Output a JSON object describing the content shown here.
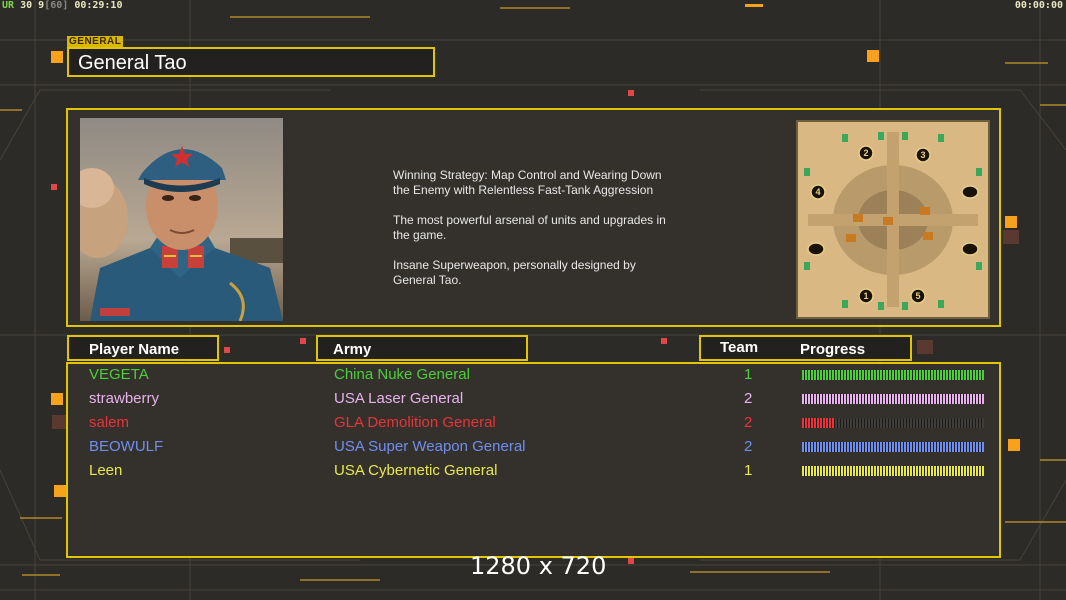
{
  "hud": {
    "rank": "UR",
    "fps": "30",
    "fps_min": "9",
    "fps_cap": "[60]",
    "elapsed": "00:29:10",
    "timer": "00:00:00"
  },
  "general": {
    "tag": "GENERAL",
    "name": "General Tao"
  },
  "description": [
    "Winning Strategy: Map Control and Wearing Down\n the Enemy with Relentless Fast-Tank Aggression",
    "The most powerful arsenal of units and upgrades in\n the game.",
    "Insane Superweapon, personally designed by\n General Tao."
  ],
  "minimap": {
    "start_positions": [
      "1",
      "2",
      "3",
      "4",
      "5"
    ]
  },
  "table": {
    "headers": {
      "player": "Player Name",
      "army": "Army",
      "team": "Team",
      "progress": "Progress"
    },
    "rows": [
      {
        "player": "VEGETA",
        "army": "China Nuke General",
        "team": "1",
        "progress": 1.0,
        "color": "#4ccf3a"
      },
      {
        "player": "strawberry",
        "army": "USA Laser General",
        "team": "2",
        "progress": 1.0,
        "color": "#e8b2ec"
      },
      {
        "player": "salem",
        "army": "GLA Demolition General",
        "team": "2",
        "progress": 0.18,
        "color": "#e8333a"
      },
      {
        "player": "BEOWULF",
        "army": "USA Super Weapon General",
        "team": "2",
        "progress": 1.0,
        "color": "#6f8ff0"
      },
      {
        "player": "Leen",
        "army": "USA Cybernetic General",
        "team": "1",
        "progress": 1.0,
        "color": "#e8e84a"
      }
    ]
  },
  "resolution": "1280 x 720",
  "colors": {
    "frame": "#e0c600",
    "background": "#2d2b28"
  }
}
